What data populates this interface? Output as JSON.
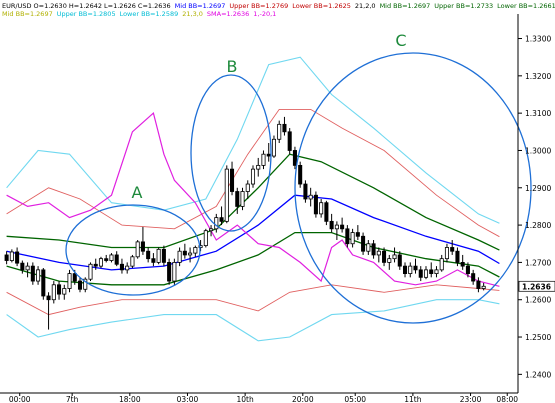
{
  "header": {
    "line1": [
      {
        "text": "EUR/USD O=1.2630 H=1.2642 L=1.2626 C=1.2636",
        "color": "#000000"
      },
      {
        "text": "Mid BB=1.2697",
        "color": "#0000ff"
      },
      {
        "text": "Upper BB=1.2769",
        "color": "#c00000"
      },
      {
        "text": "Lower BB=1.2625",
        "color": "#c00000"
      },
      {
        "text": "21,2,0",
        "color": "#000000"
      },
      {
        "text": "Mid BB=1.2697",
        "color": "#006400"
      },
      {
        "text": "Upper BB=1.2733",
        "color": "#006400"
      },
      {
        "text": "Lower BB=1.2661",
        "color": "#006400"
      },
      {
        "text": "21,1,0",
        "color": "#000000"
      }
    ],
    "line2": [
      {
        "text": "Mid BB=1.2697",
        "color": "#b0b000"
      },
      {
        "text": "Upper BB=1.2805",
        "color": "#00bcd4"
      },
      {
        "text": "Lower BB=1.2589",
        "color": "#00bcd4"
      },
      {
        "text": "21,3,0",
        "color": "#b0b000"
      },
      {
        "text": "SMA=1.2636",
        "color": "#e000e0"
      },
      {
        "text": "1,-20,1",
        "color": "#e000e0"
      }
    ]
  },
  "annotations": [
    {
      "label": "A",
      "color": "#1e8a3c",
      "circle_color": "#1e6fd6"
    },
    {
      "label": "B",
      "color": "#1e8a3c",
      "circle_color": "#1e6fd6"
    },
    {
      "label": "C",
      "color": "#1e8a3c",
      "circle_color": "#1e6fd6"
    }
  ],
  "current_price": "1.2636",
  "colors": {
    "bull": "#ffffff",
    "bear": "#000000",
    "mid": "#0000ff",
    "bb2": "#e06060",
    "bb1": "#006400",
    "bb3": "#70d8f0",
    "sma": "#e020e0"
  },
  "chart_data": {
    "type": "candlestick",
    "symbol": "EUR/USD",
    "ylim": [
      1.235,
      1.3355
    ],
    "y_ticks": [
      "1.2400",
      "1.2500",
      "1.2600",
      "1.2700",
      "1.2800",
      "1.2900",
      "1.3000",
      "1.3100",
      "1.3200",
      "1.3300"
    ],
    "x_ticks": [
      "00:00",
      "7th",
      "18:00",
      "03:00",
      "10th",
      "20:00",
      "05:00",
      "11th",
      "23:00",
      "08:00"
    ],
    "n_bars": 95,
    "bars": [
      [
        1.272,
        1.273,
        1.2695,
        1.2705
      ],
      [
        1.2705,
        1.2735,
        1.27,
        1.2728
      ],
      [
        1.2728,
        1.274,
        1.269,
        1.2698
      ],
      [
        1.2698,
        1.2705,
        1.267,
        1.268
      ],
      [
        1.268,
        1.27,
        1.266,
        1.269
      ],
      [
        1.269,
        1.27,
        1.264,
        1.265
      ],
      [
        1.265,
        1.269,
        1.264,
        1.268
      ],
      [
        1.268,
        1.2685,
        1.26,
        1.261
      ],
      [
        1.261,
        1.262,
        1.252,
        1.26
      ],
      [
        1.26,
        1.265,
        1.259,
        1.264
      ],
      [
        1.264,
        1.265,
        1.26,
        1.2615
      ],
      [
        1.2615,
        1.264,
        1.26,
        1.263
      ],
      [
        1.263,
        1.268,
        1.262,
        1.267
      ],
      [
        1.267,
        1.268,
        1.264,
        1.265
      ],
      [
        1.265,
        1.266,
        1.262,
        1.2628
      ],
      [
        1.2628,
        1.266,
        1.262,
        1.2655
      ],
      [
        1.2655,
        1.27,
        1.265,
        1.2695
      ],
      [
        1.2695,
        1.271,
        1.268,
        1.269
      ],
      [
        1.269,
        1.2715,
        1.2685,
        1.271
      ],
      [
        1.271,
        1.272,
        1.27,
        1.2705
      ],
      [
        1.2705,
        1.2725,
        1.27,
        1.272
      ],
      [
        1.272,
        1.273,
        1.269,
        1.2695
      ],
      [
        1.2695,
        1.271,
        1.267,
        1.268
      ],
      [
        1.268,
        1.27,
        1.267,
        1.269
      ],
      [
        1.269,
        1.272,
        1.2685,
        1.2715
      ],
      [
        1.2715,
        1.276,
        1.271,
        1.2755
      ],
      [
        1.2755,
        1.2795,
        1.272,
        1.273
      ],
      [
        1.273,
        1.274,
        1.27,
        1.271
      ],
      [
        1.271,
        1.2725,
        1.269,
        1.27
      ],
      [
        1.27,
        1.274,
        1.2695,
        1.2735
      ],
      [
        1.2735,
        1.2745,
        1.269,
        1.27
      ],
      [
        1.27,
        1.271,
        1.264,
        1.265
      ],
      [
        1.265,
        1.271,
        1.264,
        1.27
      ],
      [
        1.27,
        1.274,
        1.269,
        1.273
      ],
      [
        1.273,
        1.275,
        1.271,
        1.272
      ],
      [
        1.272,
        1.274,
        1.27,
        1.2725
      ],
      [
        1.2725,
        1.2745,
        1.2715,
        1.274
      ],
      [
        1.274,
        1.276,
        1.273,
        1.2745
      ],
      [
        1.2745,
        1.279,
        1.274,
        1.2785
      ],
      [
        1.2785,
        1.28,
        1.277,
        1.279
      ],
      [
        1.279,
        1.283,
        1.278,
        1.282
      ],
      [
        1.282,
        1.285,
        1.28,
        1.281
      ],
      [
        1.281,
        1.296,
        1.2805,
        1.295
      ],
      [
        1.295,
        1.297,
        1.288,
        1.289
      ],
      [
        1.289,
        1.29,
        1.283,
        1.285
      ],
      [
        1.285,
        1.29,
        1.284,
        1.289
      ],
      [
        1.289,
        1.292,
        1.287,
        1.291
      ],
      [
        1.291,
        1.296,
        1.29,
        1.295
      ],
      [
        1.295,
        1.298,
        1.293,
        1.296
      ],
      [
        1.296,
        1.3,
        1.295,
        1.299
      ],
      [
        1.299,
        1.302,
        1.297,
        1.2985
      ],
      [
        1.2985,
        1.304,
        1.298,
        1.303
      ],
      [
        1.303,
        1.308,
        1.302,
        1.307
      ],
      [
        1.307,
        1.309,
        1.304,
        1.305
      ],
      [
        1.305,
        1.306,
        1.299,
        1.3
      ],
      [
        1.3,
        1.301,
        1.295,
        1.296
      ],
      [
        1.296,
        1.297,
        1.29,
        1.291
      ],
      [
        1.291,
        1.292,
        1.286,
        1.287
      ],
      [
        1.287,
        1.29,
        1.285,
        1.288
      ],
      [
        1.288,
        1.289,
        1.282,
        1.283
      ],
      [
        1.283,
        1.287,
        1.282,
        1.286
      ],
      [
        1.286,
        1.2865,
        1.28,
        1.281
      ],
      [
        1.281,
        1.283,
        1.278,
        1.279
      ],
      [
        1.279,
        1.281,
        1.276,
        1.28
      ],
      [
        1.28,
        1.282,
        1.278,
        1.279
      ],
      [
        1.279,
        1.28,
        1.274,
        1.275
      ],
      [
        1.275,
        1.279,
        1.274,
        1.278
      ],
      [
        1.278,
        1.28,
        1.276,
        1.277
      ],
      [
        1.277,
        1.278,
        1.272,
        1.273
      ],
      [
        1.273,
        1.276,
        1.272,
        1.275
      ],
      [
        1.275,
        1.276,
        1.271,
        1.272
      ],
      [
        1.272,
        1.274,
        1.27,
        1.273
      ],
      [
        1.273,
        1.274,
        1.269,
        1.27
      ],
      [
        1.27,
        1.272,
        1.268,
        1.271
      ],
      [
        1.271,
        1.274,
        1.27,
        1.272
      ],
      [
        1.272,
        1.273,
        1.268,
        1.269
      ],
      [
        1.269,
        1.27,
        1.266,
        1.267
      ],
      [
        1.267,
        1.27,
        1.266,
        1.269
      ],
      [
        1.269,
        1.271,
        1.267,
        1.268
      ],
      [
        1.268,
        1.269,
        1.265,
        1.266
      ],
      [
        1.266,
        1.269,
        1.2655,
        1.268
      ],
      [
        1.268,
        1.27,
        1.266,
        1.267
      ],
      [
        1.267,
        1.269,
        1.266,
        1.268
      ],
      [
        1.268,
        1.272,
        1.2675,
        1.271
      ],
      [
        1.271,
        1.275,
        1.27,
        1.274
      ],
      [
        1.274,
        1.276,
        1.272,
        1.273
      ],
      [
        1.273,
        1.274,
        1.269,
        1.27
      ],
      [
        1.27,
        1.272,
        1.268,
        1.269
      ],
      [
        1.269,
        1.27,
        1.266,
        1.267
      ],
      [
        1.267,
        1.268,
        1.264,
        1.265
      ],
      [
        1.265,
        1.266,
        1.262,
        1.263
      ],
      [
        1.263,
        1.2645,
        1.2625,
        1.2636
      ]
    ],
    "series": [
      {
        "key": "mid",
        "points": [
          [
            0,
            1.273
          ],
          [
            10,
            1.27
          ],
          [
            20,
            1.268
          ],
          [
            30,
            1.269
          ],
          [
            40,
            1.273
          ],
          [
            48,
            1.28
          ],
          [
            55,
            1.288
          ],
          [
            62,
            1.287
          ],
          [
            70,
            1.282
          ],
          [
            80,
            1.277
          ],
          [
            90,
            1.273
          ],
          [
            94,
            1.2697
          ]
        ]
      },
      {
        "key": "bb1u",
        "points": [
          [
            0,
            1.277
          ],
          [
            10,
            1.276
          ],
          [
            20,
            1.274
          ],
          [
            30,
            1.274
          ],
          [
            40,
            1.279
          ],
          [
            48,
            1.29
          ],
          [
            54,
            1.299
          ],
          [
            60,
            1.297
          ],
          [
            70,
            1.29
          ],
          [
            80,
            1.282
          ],
          [
            90,
            1.276
          ],
          [
            94,
            1.2733
          ]
        ]
      },
      {
        "key": "bb1l",
        "points": [
          [
            0,
            1.269
          ],
          [
            10,
            1.265
          ],
          [
            20,
            1.264
          ],
          [
            30,
            1.264
          ],
          [
            40,
            1.268
          ],
          [
            48,
            1.272
          ],
          [
            55,
            1.278
          ],
          [
            62,
            1.278
          ],
          [
            70,
            1.274
          ],
          [
            80,
            1.271
          ],
          [
            90,
            1.269
          ],
          [
            94,
            1.2661
          ]
        ]
      },
      {
        "key": "bb2u",
        "points": [
          [
            0,
            1.283
          ],
          [
            8,
            1.29
          ],
          [
            14,
            1.287
          ],
          [
            22,
            1.28
          ],
          [
            32,
            1.279
          ],
          [
            40,
            1.285
          ],
          [
            46,
            1.299
          ],
          [
            52,
            1.311
          ],
          [
            58,
            1.311
          ],
          [
            64,
            1.306
          ],
          [
            72,
            1.3
          ],
          [
            82,
            1.288
          ],
          [
            90,
            1.28
          ],
          [
            94,
            1.2769
          ]
        ]
      },
      {
        "key": "bb2l",
        "points": [
          [
            0,
            1.262
          ],
          [
            8,
            1.256
          ],
          [
            14,
            1.258
          ],
          [
            22,
            1.26
          ],
          [
            32,
            1.26
          ],
          [
            40,
            1.26
          ],
          [
            48,
            1.257
          ],
          [
            54,
            1.262
          ],
          [
            62,
            1.264
          ],
          [
            72,
            1.262
          ],
          [
            82,
            1.264
          ],
          [
            90,
            1.263
          ],
          [
            94,
            1.2625
          ]
        ]
      },
      {
        "key": "bb3u",
        "points": [
          [
            0,
            1.29
          ],
          [
            6,
            1.3
          ],
          [
            12,
            1.299
          ],
          [
            20,
            1.286
          ],
          [
            30,
            1.284
          ],
          [
            38,
            1.287
          ],
          [
            44,
            1.303
          ],
          [
            50,
            1.323
          ],
          [
            56,
            1.325
          ],
          [
            62,
            1.315
          ],
          [
            70,
            1.306
          ],
          [
            80,
            1.294
          ],
          [
            90,
            1.283
          ],
          [
            94,
            1.2805
          ]
        ]
      },
      {
        "key": "bb3l",
        "points": [
          [
            0,
            1.256
          ],
          [
            6,
            1.25
          ],
          [
            12,
            1.252
          ],
          [
            20,
            1.254
          ],
          [
            30,
            1.256
          ],
          [
            40,
            1.256
          ],
          [
            48,
            1.249
          ],
          [
            54,
            1.25
          ],
          [
            62,
            1.256
          ],
          [
            72,
            1.257
          ],
          [
            82,
            1.26
          ],
          [
            90,
            1.26
          ],
          [
            94,
            1.2589
          ]
        ]
      },
      {
        "key": "sma",
        "points": [
          [
            0,
            1.288
          ],
          [
            4,
            1.285
          ],
          [
            8,
            1.286
          ],
          [
            12,
            1.282
          ],
          [
            16,
            1.284
          ],
          [
            20,
            1.288
          ],
          [
            24,
            1.305
          ],
          [
            28,
            1.31
          ],
          [
            30,
            1.299
          ],
          [
            32,
            1.292
          ],
          [
            36,
            1.286
          ],
          [
            40,
            1.276
          ],
          [
            44,
            1.28
          ],
          [
            48,
            1.275
          ],
          [
            52,
            1.274
          ],
          [
            56,
            1.27
          ],
          [
            60,
            1.265
          ],
          [
            62,
            1.274
          ],
          [
            64,
            1.276
          ],
          [
            66,
            1.272
          ],
          [
            70,
            1.27
          ],
          [
            74,
            1.265
          ],
          [
            78,
            1.264
          ],
          [
            82,
            1.265
          ],
          [
            86,
            1.268
          ],
          [
            90,
            1.265
          ],
          [
            94,
            1.2636
          ]
        ]
      }
    ]
  }
}
